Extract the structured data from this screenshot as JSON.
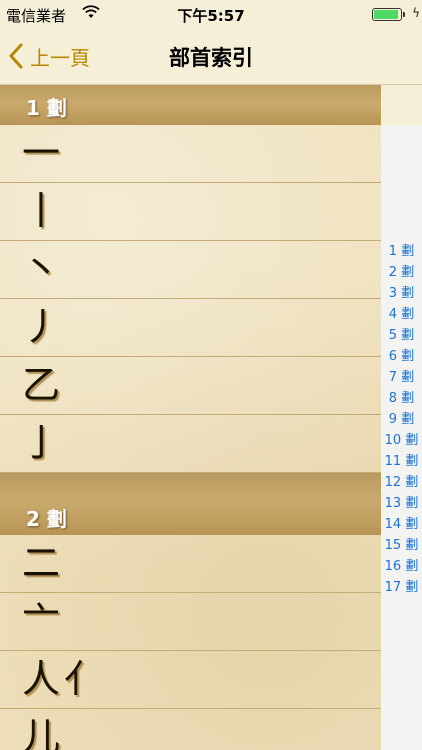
{
  "status_bar": {
    "carrier": "電信業者",
    "time": "下午5:57",
    "battery_level": 1.0
  },
  "nav": {
    "back_label": "上一頁",
    "title": "部首索引"
  },
  "sections": [
    {
      "header": "1 劃",
      "rows": [
        {
          "radicals": [
            "一"
          ]
        },
        {
          "radicals": [
            "丨"
          ]
        },
        {
          "radicals": [
            "丶"
          ]
        },
        {
          "radicals": [
            "丿"
          ]
        },
        {
          "radicals": [
            "乙"
          ]
        },
        {
          "radicals": [
            "亅"
          ]
        }
      ]
    },
    {
      "header": "2 劃",
      "rows": [
        {
          "radicals": [
            "二"
          ]
        },
        {
          "radicals": [
            "亠"
          ]
        },
        {
          "radicals": [
            "人",
            "亻"
          ]
        },
        {
          "radicals": [
            "儿"
          ]
        }
      ]
    }
  ],
  "index": [
    "1 劃",
    "2 劃",
    "3 劃",
    "4 劃",
    "5 劃",
    "6 劃",
    "7 劃",
    "8 劃",
    "9 劃",
    "10 劃",
    "11 劃",
    "12 劃",
    "13 劃",
    "14 劃",
    "15 劃",
    "16 劃",
    "17 劃"
  ],
  "icons": {
    "wifi": "wifi-icon",
    "battery": "battery-icon",
    "back": "chevron-left-icon"
  },
  "colors": {
    "accent": "#b88600",
    "index_text": "#1a73d9",
    "header_bg": "#c0a063"
  }
}
